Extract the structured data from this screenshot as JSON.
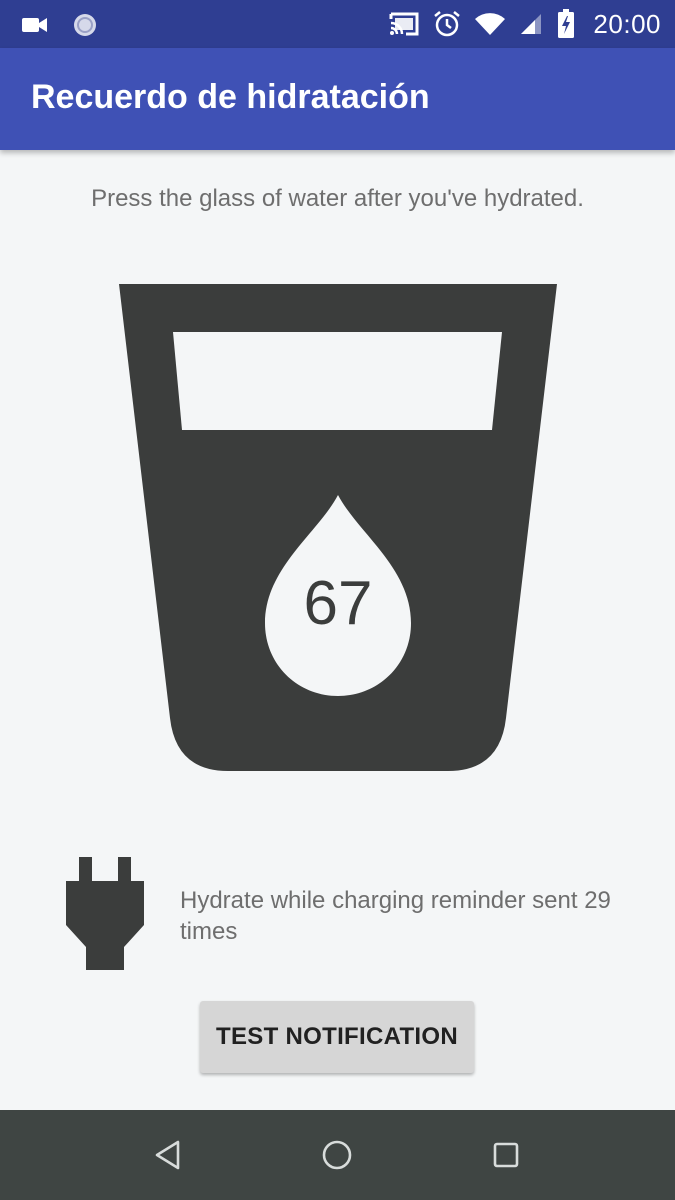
{
  "status_bar": {
    "left_icons": [
      "video-camera-icon",
      "app-notification-icon"
    ],
    "right_icons": [
      "cast-icon",
      "alarm-icon",
      "wifi-icon",
      "cellular-signal-icon",
      "battery-charging-icon"
    ],
    "time": "20:00"
  },
  "app_bar": {
    "title": "Recuerdo de hidratación"
  },
  "main": {
    "instructions": "Press the glass of water after you've hydrated.",
    "water_count": "67",
    "glass_icon": "water-glass-icon",
    "drop_icon": "water-drop-icon",
    "charging_icon": "power-plug-icon",
    "charging_reminder_text": "Hydrate while charging reminder sent 29 times",
    "test_button_label": "TEST NOTIFICATION"
  },
  "nav_bar": {
    "buttons": [
      "back-icon",
      "home-icon",
      "recents-icon"
    ]
  },
  "colors": {
    "status_bar": "#2F3E92",
    "app_bar": "#3F51B5",
    "background": "#F4F6F7",
    "glass": "#3B3D3C",
    "nav_bar": "#3F4543",
    "button": "#D6D6D6",
    "secondary_text": "#6E6E6E"
  }
}
